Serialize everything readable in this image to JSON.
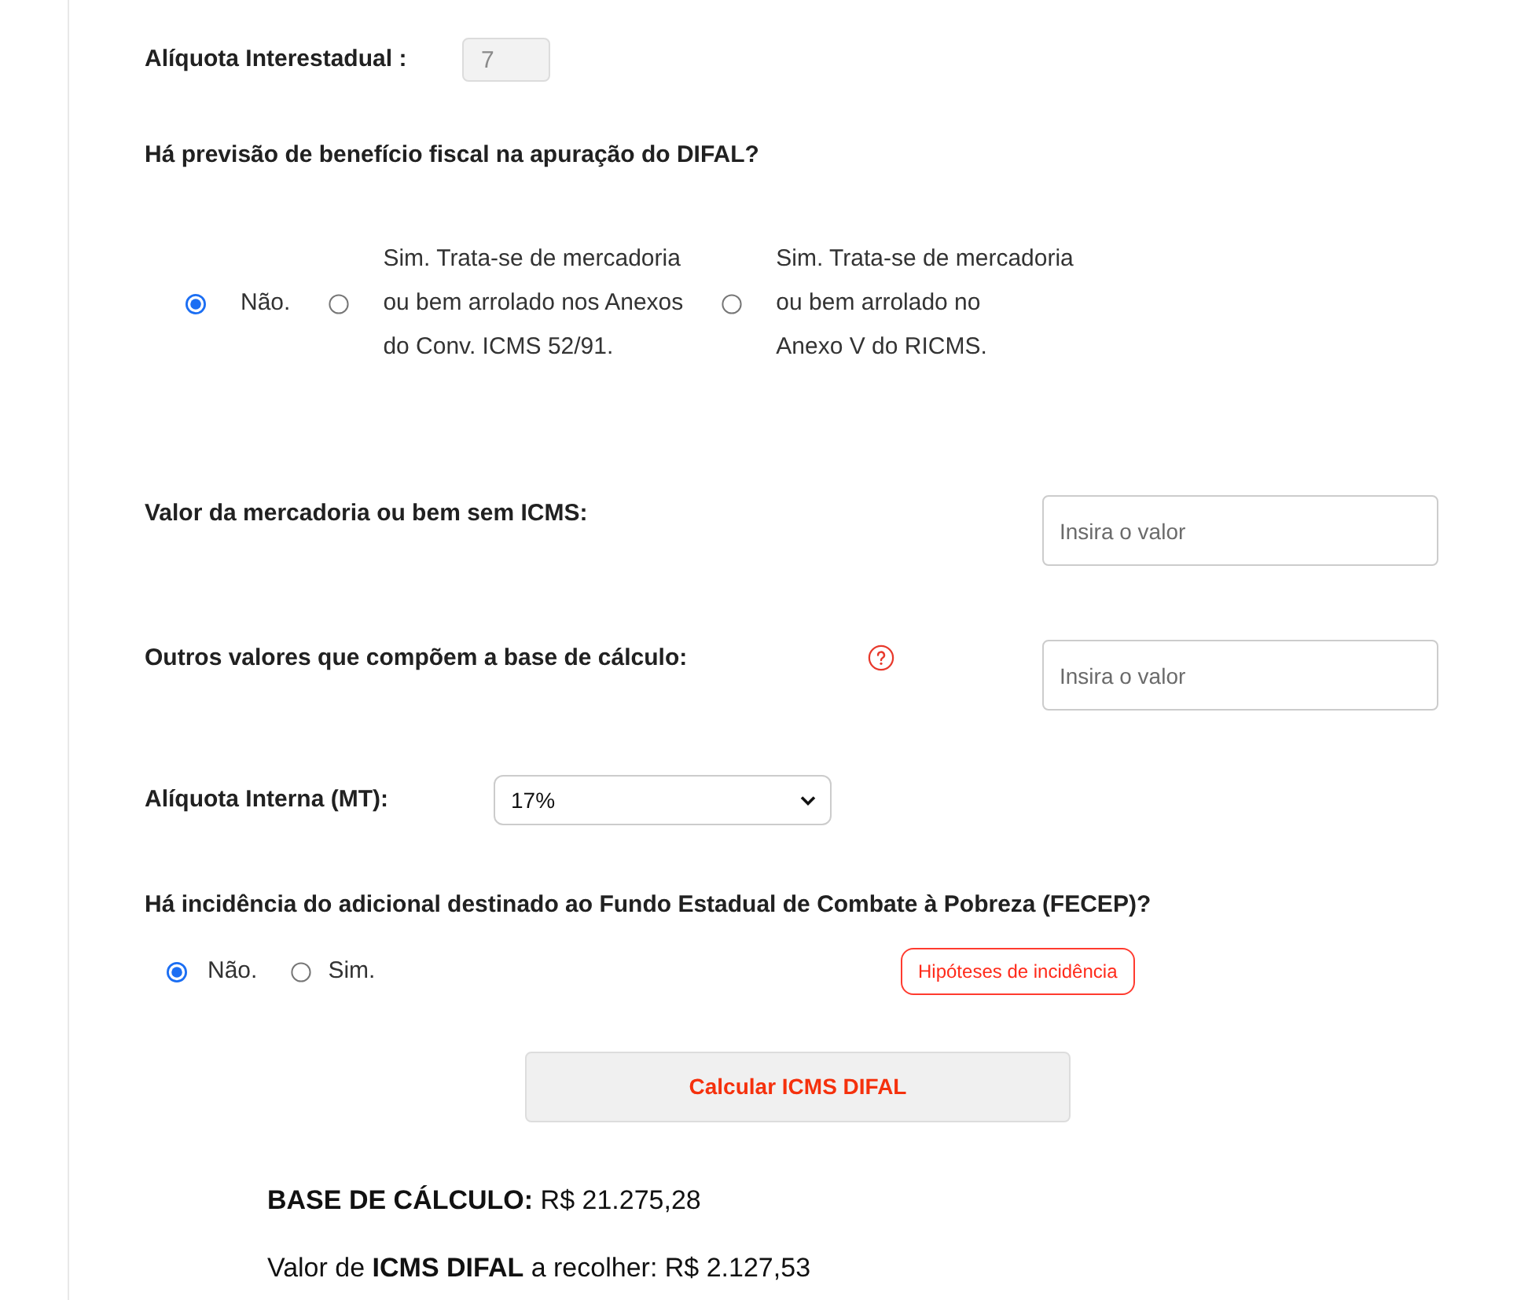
{
  "interstate_rate": {
    "label": "Alíquota Interestadual :",
    "value": "7",
    "disabled": true
  },
  "benefit": {
    "question": "Há previsão de benefício fiscal na apuração do DIFAL?",
    "options": [
      {
        "lines": [
          "Não."
        ],
        "selected": true
      },
      {
        "lines": [
          "Sim. Trata-se de mercadoria",
          "ou bem arrolado nos Anexos",
          "do Conv. ICMS 52/91."
        ],
        "selected": false
      },
      {
        "lines": [
          "Sim. Trata-se de mercadoria",
          "ou bem arrolado no",
          "Anexo V do RICMS."
        ],
        "selected": false
      }
    ]
  },
  "amount_fields": [
    {
      "label": "Valor da mercadoria ou bem sem ICMS:",
      "placeholder": "Insira o valor",
      "help": false
    },
    {
      "label": "Outros valores que compõem a base de cálculo:",
      "placeholder": "Insira o valor",
      "help": true
    }
  ],
  "internal_rate": {
    "label": "Alíquota Interna (MT):",
    "value": "17%"
  },
  "fecep": {
    "question": "Há incidência do adicional destinado ao Fundo Estadual de Combate à Pobreza (FECEP)?",
    "options": [
      {
        "label": "Não.",
        "selected": true
      },
      {
        "label": "Sim.",
        "selected": false
      }
    ],
    "info_button": "Hipóteses de incidência"
  },
  "calculate_button": "Calcular ICMS DIFAL",
  "results": [
    "**BASE DE CÁLCULO:** R$ 21.275,28",
    "Valor de **ICMS DIFAL** a recolher: R$ 2.127,53"
  ]
}
